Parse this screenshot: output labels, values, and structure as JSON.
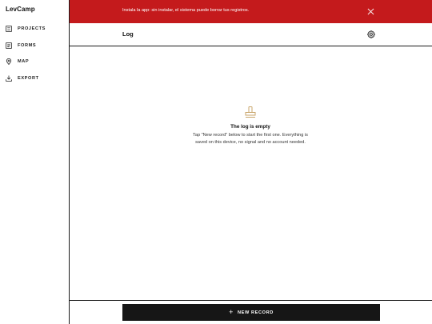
{
  "app": {
    "name": "LevCamp"
  },
  "sidebar": {
    "items": [
      {
        "label": "PROJECTS",
        "icon": "grid-icon"
      },
      {
        "label": "FORMS",
        "icon": "document-icon"
      },
      {
        "label": "MAP",
        "icon": "map-pin-icon"
      },
      {
        "label": "EXPORT",
        "icon": "download-icon"
      }
    ]
  },
  "banner": {
    "text": "Instala la app: sin instalar, el sistema puede borrar tus registros.",
    "color": "#c41a1c",
    "close_icon": "close-icon"
  },
  "header": {
    "title": "Log",
    "settings_icon": "gear-icon"
  },
  "empty_state": {
    "icon": "stamp-icon",
    "title": "The log is empty",
    "description": "Tap \"New record\" below to start the first one. Everything is saved on this device, no signal and no account needed."
  },
  "footer": {
    "new_record_label": "NEW RECORD",
    "button_color": "#161616"
  },
  "colors": {
    "accent": "#c41a1c",
    "empty_icon": "#c9a66b"
  }
}
